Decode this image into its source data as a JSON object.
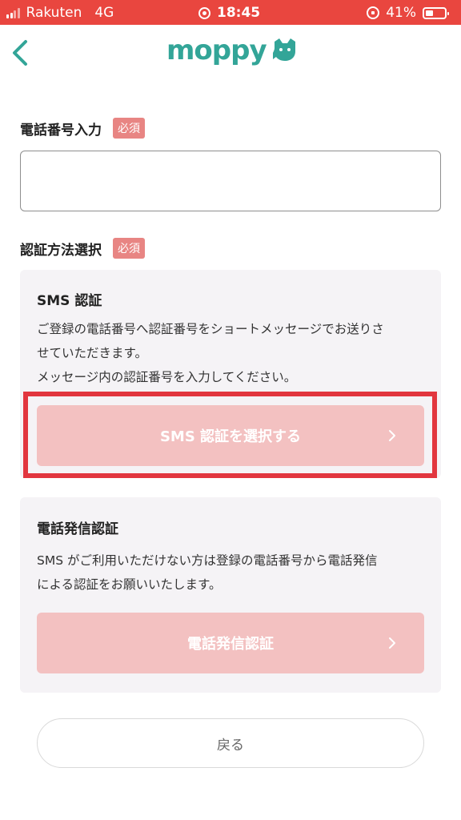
{
  "status_bar": {
    "carrier": "Rakuten",
    "network": "4G",
    "time": "18:45",
    "battery": "41%",
    "battery_level": 0.41,
    "icons": [
      "signal-icon",
      "screen-record-icon",
      "orientation-lock-icon",
      "battery-icon"
    ]
  },
  "header": {
    "logo_text": "moppy",
    "back_icon": "chevron-left-icon",
    "accent_color": "#33a598"
  },
  "form": {
    "phone_label": "電話番号入力",
    "required_badge": "必須",
    "phone_value": "",
    "method_label": "認証方法選択"
  },
  "sms": {
    "title": "SMS 認証",
    "desc_lines": [
      "ご登録の電話番号へ認証番号をショートメッセージでお送りさ",
      "せていただきます。",
      "メッセージ内の認証番号を入力してください。"
    ],
    "button": "SMS 認証を選択する"
  },
  "call": {
    "title": "電話発信認証",
    "desc_lines": [
      "SMS がご利用いただけない方は登録の電話番号から電話発信",
      "による認証をお願いいたします。"
    ],
    "button": "電話発信認証"
  },
  "back_button": "戻る",
  "colors": {
    "status_bar": "#e9463f",
    "button_disabled": "#f3c1c1",
    "required_badge": "#e88583",
    "highlight_border": "#e2363f",
    "card_bg": "#f5f3f6"
  }
}
